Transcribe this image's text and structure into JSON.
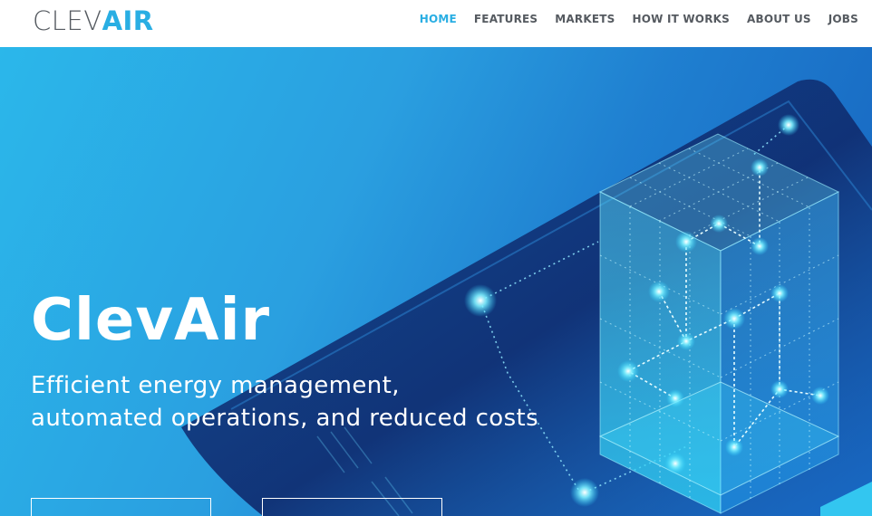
{
  "brand": {
    "logo_part1": "CLEV",
    "logo_part2": "AIR",
    "color_gray": "#555a60",
    "color_blue": "#29aee3"
  },
  "nav": {
    "items": [
      {
        "label": "HOME",
        "active": true
      },
      {
        "label": "FEATURES",
        "active": false
      },
      {
        "label": "MARKETS",
        "active": false
      },
      {
        "label": "HOW IT WORKS",
        "active": false
      },
      {
        "label": "ABOUT US",
        "active": false
      },
      {
        "label": "JOBS",
        "active": false
      }
    ]
  },
  "hero": {
    "title": "ClevAir",
    "subtitle_line1": "Efficient energy management,",
    "subtitle_line2": "automated operations, and reduced costs",
    "buttons": [
      {
        "label": ""
      },
      {
        "label": ""
      }
    ],
    "illustration": "isometric-building-network-icon"
  }
}
